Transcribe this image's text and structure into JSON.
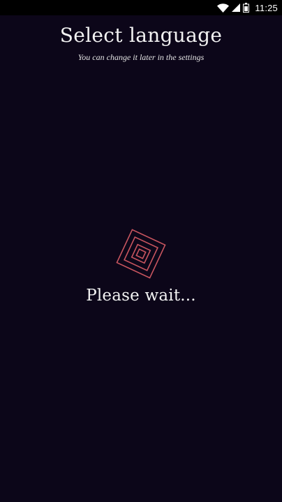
{
  "status_bar": {
    "time": "11:25",
    "icons": [
      "wifi-icon",
      "cell-signal-icon",
      "battery-icon"
    ]
  },
  "header": {
    "title": "Select language",
    "subtitle": "You can change it later in the settings"
  },
  "loading": {
    "icon": "diamond-loader-icon",
    "text": "Please wait..."
  },
  "colors": {
    "background": "#0c0619",
    "accent": "#c8555f",
    "text": "#f2f2f2"
  }
}
